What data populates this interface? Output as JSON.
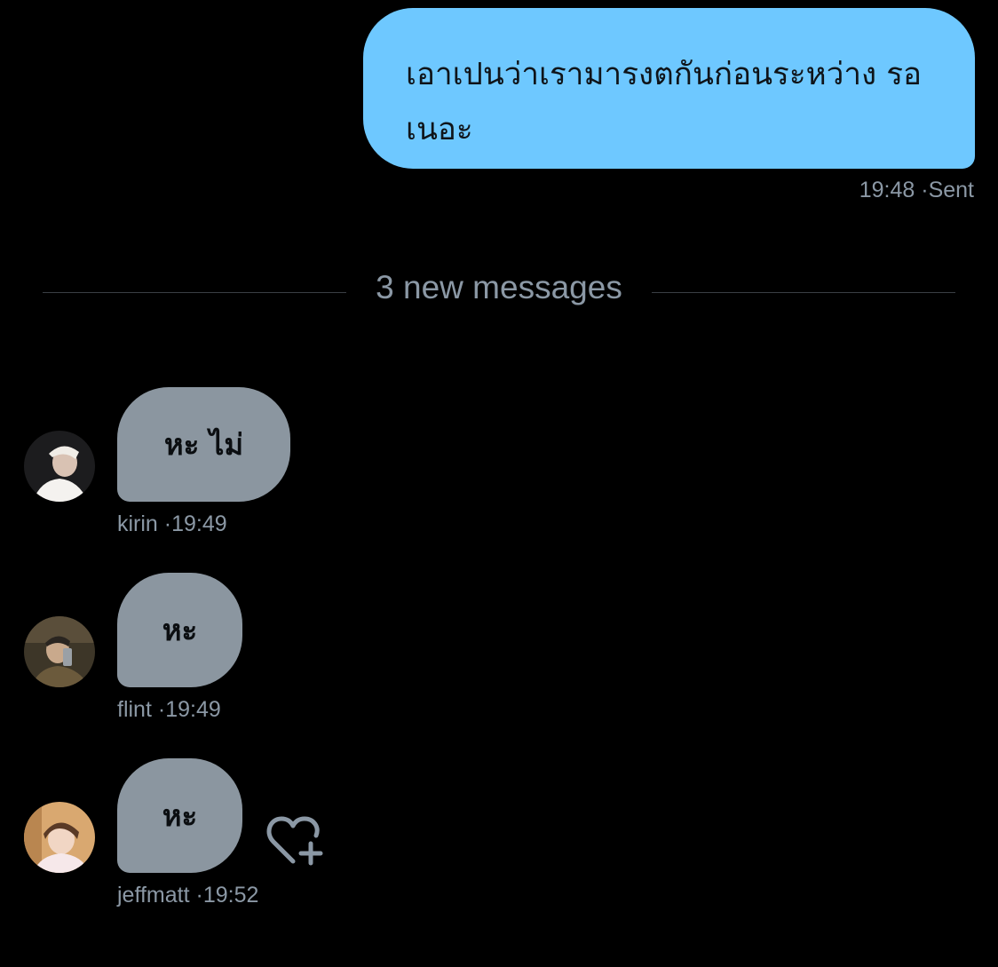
{
  "conversation": {
    "sent_message": {
      "text": "เอาเปนว่าเรามารงตกันก่อนระหว่าง รอเนอะ",
      "time": "19:48",
      "separator": "·",
      "status": "Sent"
    },
    "divider": {
      "label": "3 new messages"
    },
    "received_messages": [
      {
        "text": "หะ ไม่",
        "sender": "kirin",
        "separator": "·",
        "time": "19:49",
        "avatar_icon": "user-avatar-photo"
      },
      {
        "text": "หะ",
        "sender": "flint",
        "separator": "·",
        "time": "19:49",
        "avatar_icon": "user-avatar-photo"
      },
      {
        "text": "หะ",
        "sender": "jeffmatt",
        "separator": "·",
        "time": "19:52",
        "avatar_icon": "user-avatar-photo"
      }
    ],
    "reaction_icon": "heart-plus-icon"
  },
  "colors": {
    "background": "#000000",
    "sent_bubble": "#6ec8ff",
    "received_bubble": "#8b96a0",
    "meta_text": "#8b98a5",
    "divider_line": "#3a3f44"
  }
}
